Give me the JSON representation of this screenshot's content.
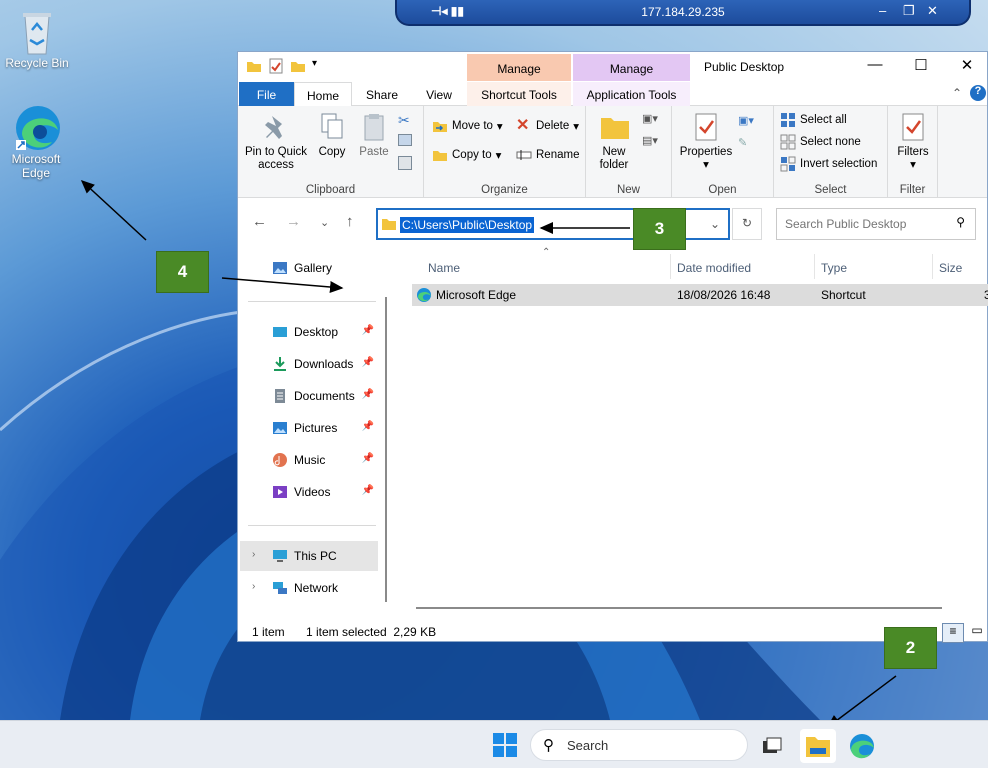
{
  "desktop": {
    "icons": [
      {
        "label": "Recycle Bin",
        "icon": "recycle-bin-icon"
      },
      {
        "label": "Microsoft Edge",
        "icon": "edge-icon"
      }
    ]
  },
  "rdp_bar": {
    "ip": "177.184.29.235",
    "icons": [
      "pin-icon",
      "signal-icon",
      "minimize-icon",
      "restore-icon",
      "close-icon"
    ]
  },
  "window": {
    "title": "Public Desktop",
    "context_groups": [
      {
        "label": "Manage",
        "tab": "Shortcut Tools",
        "color": "#f9c9b0"
      },
      {
        "label": "Manage",
        "tab": "Application Tools",
        "color": "#e3c7f3"
      }
    ],
    "tabs": [
      "File",
      "Home",
      "Share",
      "View"
    ],
    "ribbon": {
      "clipboard": {
        "label": "Clipboard",
        "pin": "Pin to Quick access",
        "copy": "Copy",
        "paste": "Paste"
      },
      "organize": {
        "label": "Organize",
        "move_to": "Move to",
        "copy_to": "Copy to",
        "delete": "Delete",
        "rename": "Rename"
      },
      "new": {
        "label": "New",
        "new_folder": "New folder"
      },
      "open": {
        "label": "Open",
        "properties": "Properties"
      },
      "select": {
        "label": "Select",
        "select_all": "Select all",
        "select_none": "Select none",
        "invert": "Invert selection"
      },
      "filter": {
        "label": "Filter",
        "filters": "Filters"
      }
    },
    "address": "C:\\Users\\Public\\Desktop",
    "search_placeholder": "Search Public Desktop",
    "nav": {
      "gallery": "Gallery",
      "quick": [
        {
          "label": "Desktop",
          "icon": "desktop-icon"
        },
        {
          "label": "Downloads",
          "icon": "download-icon"
        },
        {
          "label": "Documents",
          "icon": "documents-icon"
        },
        {
          "label": "Pictures",
          "icon": "pictures-icon"
        },
        {
          "label": "Music",
          "icon": "music-icon"
        },
        {
          "label": "Videos",
          "icon": "videos-icon"
        }
      ],
      "this_pc": "This PC",
      "network": "Network"
    },
    "columns": {
      "name": "Name",
      "date": "Date modified",
      "type": "Type",
      "size": "Size"
    },
    "rows": [
      {
        "name": "Microsoft Edge",
        "date": "18/08/2026 16:48",
        "type": "Shortcut",
        "size": "3"
      }
    ],
    "status": {
      "count": "1 item",
      "selected": "1 item selected  2,29 KB"
    }
  },
  "callouts": [
    "2",
    "3",
    "4"
  ],
  "taskbar": {
    "search": "Search"
  },
  "colors": {
    "accent": "#1f6fc5",
    "callout": "#4a8a26"
  }
}
